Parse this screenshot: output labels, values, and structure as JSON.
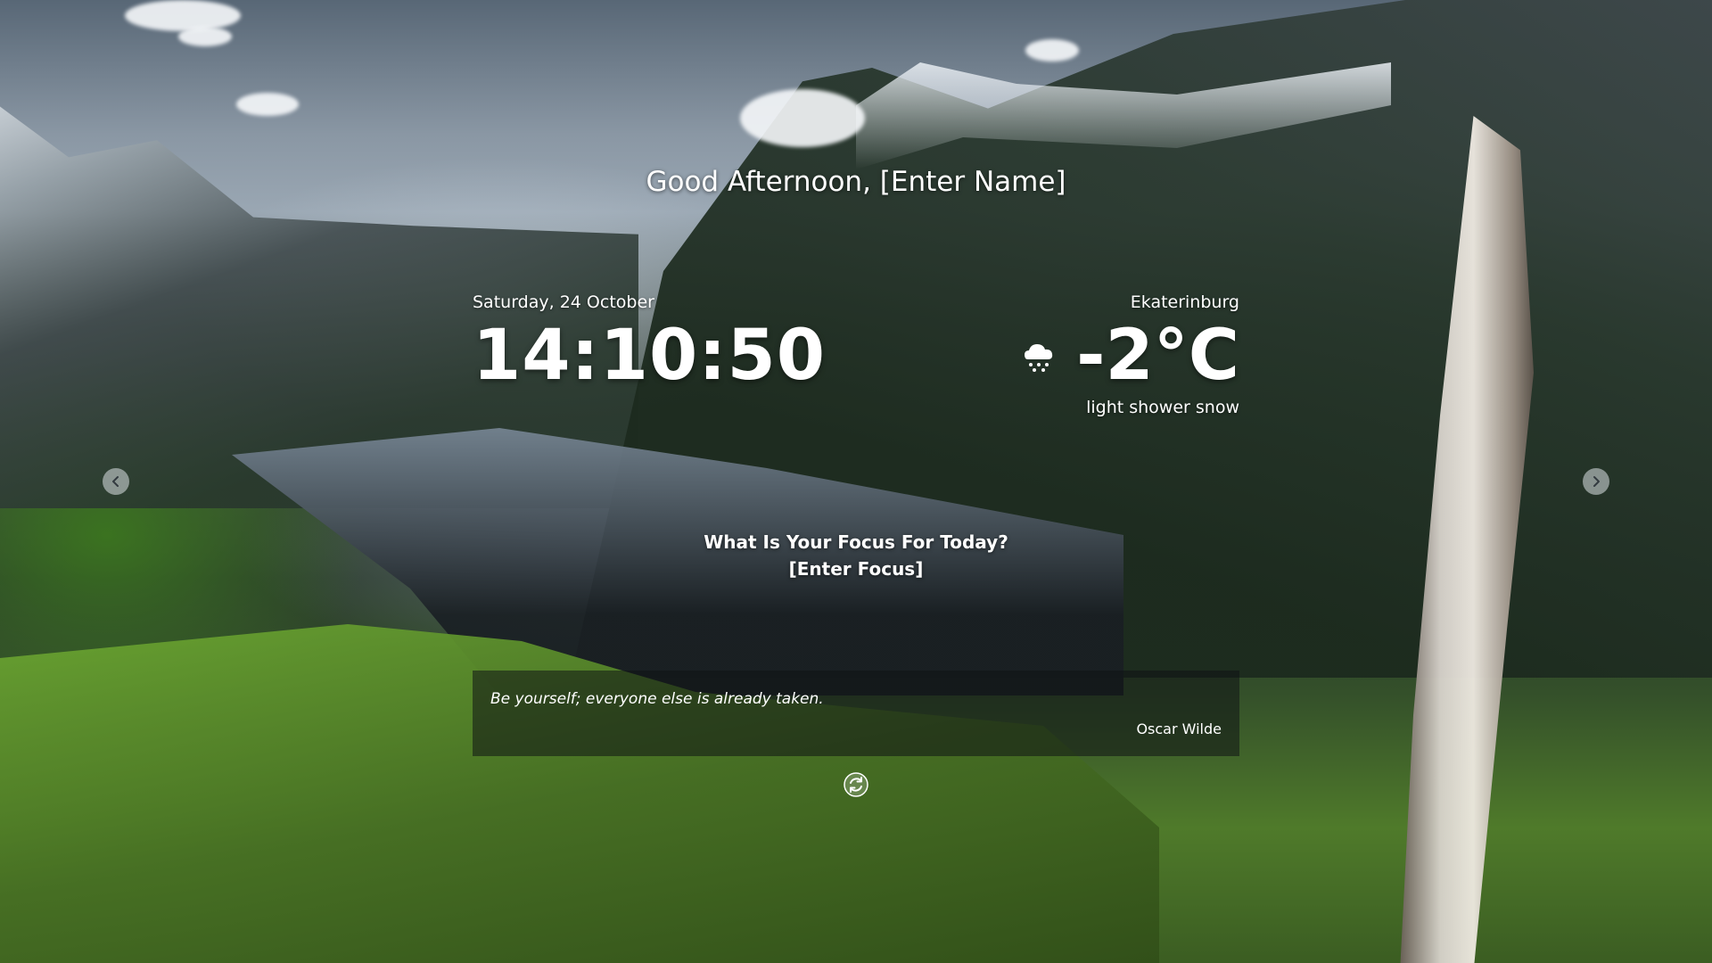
{
  "greeting": {
    "prefix": "Good Afternoon, ",
    "name_placeholder": "[Enter Name]"
  },
  "clock": {
    "date": "Saturday, 24 October",
    "time": "14:10:50"
  },
  "weather": {
    "city": "Ekaterinburg",
    "temperature": "-2°C",
    "description": "light shower snow",
    "icon": "snow-cloud-icon"
  },
  "focus": {
    "question": "What Is Your Focus For Today?",
    "placeholder": "[Enter Focus]"
  },
  "navigation": {
    "prev_icon": "chevron-left-icon",
    "next_icon": "chevron-right-icon"
  },
  "quote": {
    "text": "Be yourself; everyone else is already taken.",
    "author": "Oscar Wilde",
    "refresh_icon": "refresh-icon"
  }
}
